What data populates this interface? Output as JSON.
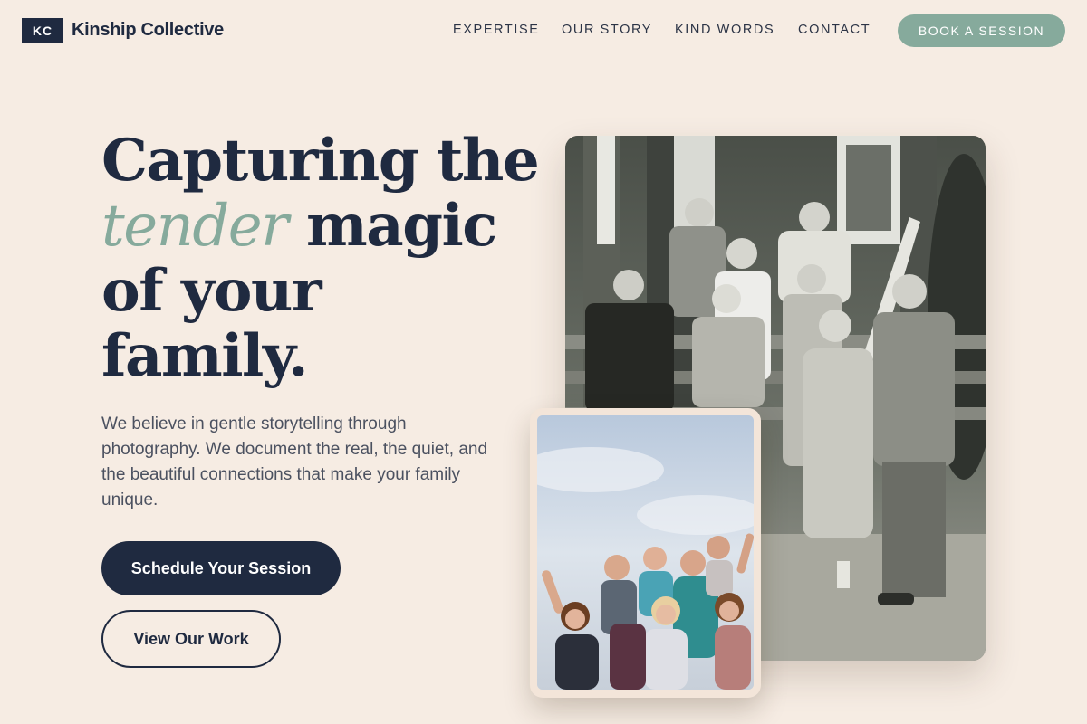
{
  "header": {
    "logo_initials": "KC",
    "brand_name": "Kinship Collective",
    "nav": [
      {
        "label": "EXPERTISE"
      },
      {
        "label": "OUR STORY"
      },
      {
        "label": "KIND WORDS"
      },
      {
        "label": "CONTACT"
      }
    ],
    "cta_label": "BOOK A SESSION"
  },
  "hero": {
    "title_line1": "Capturing the",
    "title_accent": "tender",
    "title_line2_rest": " magic",
    "title_line3": "of your",
    "title_line4": "family.",
    "description": "We believe in gentle storytelling through photography. We document the real, the quiet, and the beautiful connections that make your family unique.",
    "primary_button": "Schedule Your Session",
    "secondary_button": "View Our Work"
  },
  "colors": {
    "background": "#f6ece3",
    "navy": "#1f2a40",
    "sage_accent": "#86aa9c"
  }
}
